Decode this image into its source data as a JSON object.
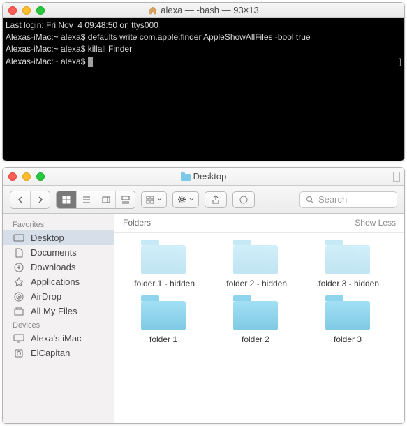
{
  "terminal": {
    "title": "alexa — -bash — 93×13",
    "lines": [
      "Last login: Fri Nov  4 09:48:50 on ttys000",
      "Alexas-iMac:~ alexa$ defaults write com.apple.finder AppleShowAllFiles -bool true",
      "Alexas-iMac:~ alexa$ killall Finder",
      "Alexas-iMac:~ alexa$ "
    ]
  },
  "finder": {
    "title": "Desktop",
    "search_placeholder": "Search",
    "sidebar": {
      "favorites_label": "Favorites",
      "devices_label": "Devices",
      "favorites": [
        {
          "label": "Desktop"
        },
        {
          "label": "Documents"
        },
        {
          "label": "Downloads"
        },
        {
          "label": "Applications"
        },
        {
          "label": "AirDrop"
        },
        {
          "label": "All My Files"
        }
      ],
      "devices": [
        {
          "label": "Alexa's iMac"
        },
        {
          "label": "ElCapitan"
        }
      ]
    },
    "section": {
      "label": "Folders",
      "toggle": "Show Less"
    },
    "folders": [
      {
        "name": ".folder 1 - hidden",
        "hidden": true
      },
      {
        "name": ".folder 2 - hidden",
        "hidden": true
      },
      {
        "name": ".folder 3 - hidden",
        "hidden": true
      },
      {
        "name": "folder 1",
        "hidden": false
      },
      {
        "name": "folder 2",
        "hidden": false
      },
      {
        "name": "folder 3",
        "hidden": false
      }
    ]
  }
}
